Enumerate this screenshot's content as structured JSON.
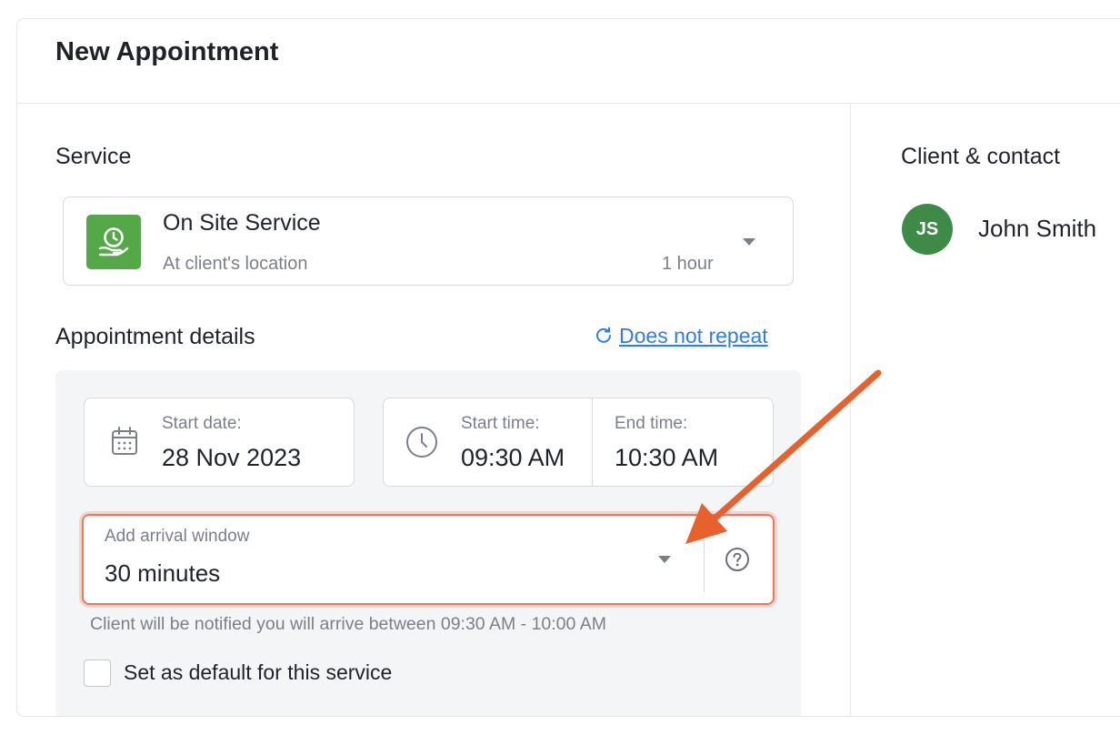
{
  "header": {
    "title": "New Appointment"
  },
  "service": {
    "section_label": "Service",
    "name": "On Site Service",
    "location": "At client's location",
    "duration": "1 hour",
    "icon": "hand-clock-icon",
    "icon_color": "#54a848"
  },
  "details": {
    "section_label": "Appointment details",
    "repeat_link": "Does not repeat",
    "start_date_label": "Start date:",
    "start_date_value": "28 Nov 2023",
    "start_time_label": "Start time:",
    "start_time_value": "09:30 AM",
    "end_time_label": "End time:",
    "end_time_value": "10:30 AM",
    "arrival_label": "Add arrival window",
    "arrival_value": "30 minutes",
    "arrival_note": "Client will be notified you will arrive between 09:30 AM - 10:00 AM",
    "default_checkbox_label": "Set as default for this service",
    "default_checked": false
  },
  "client": {
    "section_label": "Client & contact",
    "avatar_initials": "JS",
    "name": "John Smith",
    "avatar_color": "#3d8b46"
  },
  "colors": {
    "accent_link": "#2d7ee8",
    "highlight_border": "#f0785a",
    "annotation_arrow": "#e8602c"
  }
}
